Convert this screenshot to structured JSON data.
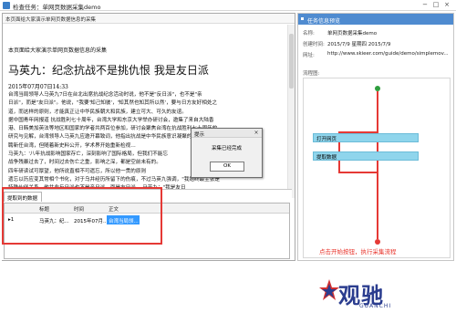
{
  "window": {
    "title": "检查任务：单网页数据采集demo",
    "controls": [
      "−",
      "□",
      "×"
    ]
  },
  "browser": {
    "url": "本页面给大家演示单网页数据信息的采集",
    "article": {
      "page_heading": "本页面给大家演示单网页数据信息的采集",
      "headline": "马英九：纪念抗战不是挑仇恨 我是友日派",
      "date": "2015年07月07日14:33",
      "paragraphs": [
        "台湾当局领导人马英九7日在台北出席抗战纪念活动时说，他不是\"反日派\"，也不是\"亲",
        "日派\"，而是\"友日派\"。他说，\"我要'知己知彼'，'知其然也知其所以然'，要与日方友好相处之",
        "道，而这样的原则，才能真正让中华民族朝大和民族，建立可大、可久的友谊。",
        "据中国青年网报道 抗战胜利七十周年，台湾大学和东京大学举办研讨会，邀集了来自大陆香",
        "港、日韩美加英法等地区和国家的学者共两百位参加，研讨会聚焦台湾在抗战胜利七十周年的",
        "研究与见解，台湾领导人马英九应邀开幕致词，他指出抗战是中华民族意识凝聚的历史，",
        "聘新任台湾，但随着新史料公开，学术界开始重新检视…",
        "马英九：'八年抗战影响国家存亡，深刻影响了国际格局，但我们不能忘",
        "战争残暴过去了，时间过去伤亡之重，影响之深，都是空前未有的。",
        "四年研读试可厚望，他所说直相不可遗忘，所以他一贯的原则",
        "遗忘以历应变其常相个书化，对于乌井经历所留下的伤痕，不过马英九强调，\"我始终最主张是",
        "特殊伙伴关系，他并非反日派也不是亲日派，而是友日派。 马英九：\"我是友日"
      ]
    }
  },
  "extracted": {
    "tab_label": "提取到的数据",
    "columns": [
      "标题",
      "时间",
      "正文"
    ],
    "rows": [
      {
        "index": "1",
        "title": "马英九：纪...",
        "time": "2015年07月...",
        "body": "台湾当局领..."
      }
    ]
  },
  "dialog": {
    "title": "提示",
    "message": "采集已经完成",
    "ok_label": "OK",
    "close": "×"
  },
  "preview": {
    "header": "任务信息预览",
    "fields": [
      {
        "label": "名称:",
        "value": "单网页数据采集demo"
      },
      {
        "label": "创建时间:",
        "value": "2015/7/9 星期四 2015/7/9"
      },
      {
        "label": "网址:",
        "value": "http://www.skieer.com/guide/demo/simplemov..."
      }
    ],
    "flow_label": "流程图:",
    "steps": [
      "打开网页",
      "提取数据"
    ]
  },
  "hint": "点击开始按钮，执行采集流程",
  "logo": {
    "text": "观驰",
    "sub": "GUANCHI"
  },
  "colors": {
    "accent": "#4f8bd0",
    "selection": "#3399ff",
    "annotation_red": "#e53935",
    "step_fill": "#8fd5ec",
    "logo_blue": "#2b3d8f"
  }
}
